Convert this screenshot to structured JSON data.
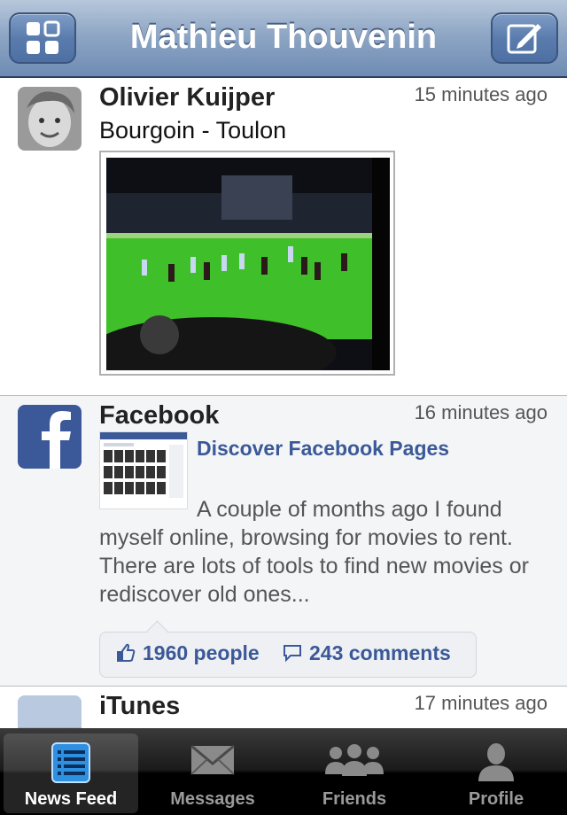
{
  "header": {
    "title": "Mathieu Thouvenin",
    "left_icon": "apps-grid-icon",
    "right_icon": "compose-icon"
  },
  "posts": [
    {
      "author": "Olivier Kuijper",
      "time": "15 minutes ago",
      "text": "Bourgoin -  Toulon",
      "attachment": "photo"
    },
    {
      "author": "Facebook",
      "time": "16 minutes ago",
      "link_title": "Discover Facebook Pages",
      "link_desc": "A couple of months ago I found myself online, browsing for movies to rent. There are lots of tools to find new movies or rediscover old ones...",
      "likes": "1960 people",
      "comments": "243 comments"
    },
    {
      "author": "iTunes",
      "time": "17 minutes ago"
    }
  ],
  "tabbar": {
    "tabs": [
      {
        "label": "News Feed",
        "icon": "news-feed-icon",
        "active": true
      },
      {
        "label": "Messages",
        "icon": "envelope-icon",
        "active": false
      },
      {
        "label": "Friends",
        "icon": "friends-icon",
        "active": false
      },
      {
        "label": "Profile",
        "icon": "profile-icon",
        "active": false
      }
    ]
  },
  "colors": {
    "brand": "#3b5998",
    "navbar": "#6d8bb3"
  }
}
